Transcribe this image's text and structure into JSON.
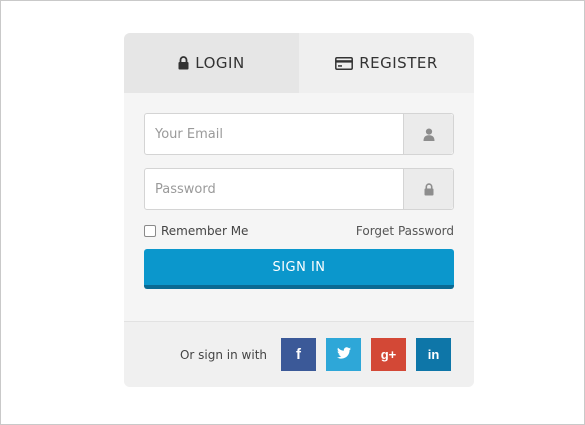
{
  "tabs": {
    "login": {
      "label": "LOGIN",
      "icon": "lock-icon"
    },
    "register": {
      "label": "REGISTER",
      "icon": "credit-card-icon"
    }
  },
  "form": {
    "email_placeholder": "Your Email",
    "email_value": "",
    "email_icon": "user-icon",
    "password_placeholder": "Password",
    "password_value": "",
    "password_icon": "lock-icon",
    "remember_label": "Remember Me",
    "remember_checked": false,
    "forgot_label": "Forget Password",
    "signin_label": "SIGN IN"
  },
  "social": {
    "prompt": "Or sign in with",
    "buttons": [
      {
        "name": "facebook",
        "glyph": "f",
        "color": "#3b5998"
      },
      {
        "name": "twitter",
        "glyph": "",
        "color": "#2ea7d8"
      },
      {
        "name": "google-plus",
        "glyph": "g+",
        "color": "#d34836"
      },
      {
        "name": "linkedin",
        "glyph": "in",
        "color": "#0e76a8"
      }
    ]
  },
  "colors": {
    "accent": "#0b97cc",
    "accent_dark": "#0a6a93"
  }
}
